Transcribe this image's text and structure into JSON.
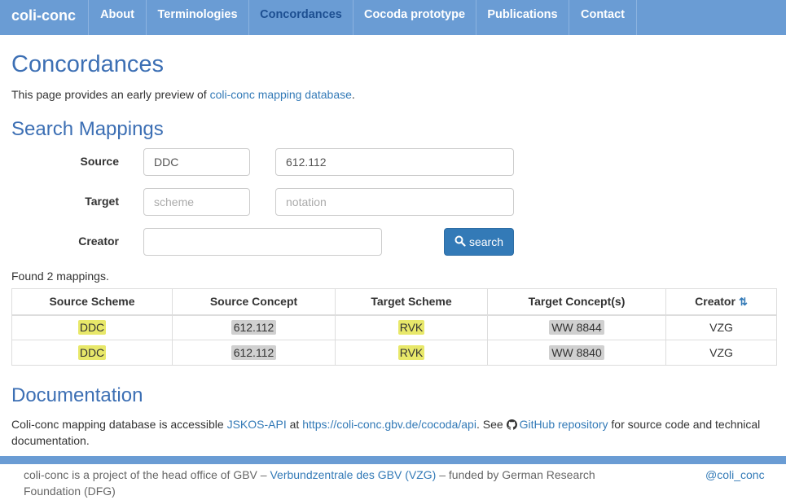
{
  "nav": {
    "brand": "coli-conc",
    "items": [
      "About",
      "Terminologies",
      "Concordances",
      "Cocoda prototype",
      "Publications",
      "Contact"
    ]
  },
  "page": {
    "title": "Concordances",
    "intro_prefix": "This page provides an early preview of ",
    "intro_link": "coli-conc mapping database",
    "intro_suffix": "."
  },
  "search": {
    "heading": "Search Mappings",
    "source_label": "Source",
    "source_scheme_value": "DDC",
    "source_notation_value": "612.112",
    "target_label": "Target",
    "target_scheme_placeholder": "scheme",
    "target_notation_placeholder": "notation",
    "creator_label": "Creator",
    "creator_value": "",
    "button_label": "search"
  },
  "results": {
    "found_text": "Found 2 mappings.",
    "columns": [
      "Source Scheme",
      "Source Concept",
      "Target Scheme",
      "Target Concept(s)",
      "Creator"
    ],
    "rows": [
      [
        "DDC",
        "612.112",
        "RVK",
        "WW 8844",
        "VZG"
      ],
      [
        "DDC",
        "612.112",
        "RVK",
        "WW 8840",
        "VZG"
      ]
    ]
  },
  "documentation": {
    "heading": "Documentation",
    "text1": "Coli-conc mapping database is accessible ",
    "link1": "JSKOS-API",
    "text2": " at ",
    "link2": "https://coli-conc.gbv.de/cocoda/api",
    "text3": ". See ",
    "link3": "GitHub repository",
    "text4": " for source code and technical documentation."
  },
  "footer": {
    "text1": "coli-conc is a project of the head office of GBV – ",
    "link": "Verbundzentrale des GBV (VZG)",
    "text2": " – funded by German Research Foundation (DFG)",
    "twitter": "@coli_conc"
  },
  "colors": {
    "navbar": "#6a9cd4",
    "heading": "#3c6fb4",
    "link": "#337ab7",
    "scheme_highlight": "#e8e86a",
    "concept_highlight": "#d0d0d0"
  },
  "icons": [
    "search-icon",
    "sort-icon",
    "github-icon"
  ]
}
